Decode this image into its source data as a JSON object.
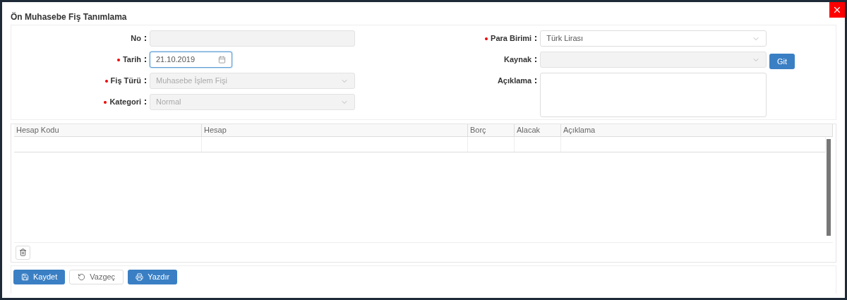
{
  "window": {
    "title": "Ön Muhasebe Fiş Tanımlama"
  },
  "form_left": [
    {
      "label": "No",
      "kind": "text",
      "required": false,
      "disabled": true,
      "focused": false
    },
    {
      "label": "Tarih",
      "kind": "date",
      "required": true,
      "disabled": false,
      "focused": true,
      "value": "21.10.2019"
    },
    {
      "label": "Fiş Türü",
      "kind": "select",
      "required": true,
      "disabled": true,
      "focused": false,
      "value": "Muhasebe İşlem Fişi"
    },
    {
      "label": "Kategori",
      "kind": "select",
      "required": true,
      "disabled": true,
      "focused": false,
      "value": "Normal"
    }
  ],
  "form_right": [
    {
      "label": "Para Birimi",
      "kind": "select",
      "required": true,
      "disabled": false,
      "focused": false,
      "value": "Türk Lirası"
    },
    {
      "label": "Kaynak",
      "kind": "select",
      "required": false,
      "disabled": true,
      "focused": false
    },
    {
      "label": "Açıklama",
      "kind": "textarea",
      "required": false,
      "disabled": false,
      "focused": false
    }
  ],
  "go_button": "Git",
  "table": {
    "columns": [
      "Hesap Kodu",
      "Hesap",
      "Borç",
      "Alacak",
      "Açıklama"
    ]
  },
  "buttons": [
    {
      "label": "Kaydet",
      "kind": "primary"
    },
    {
      "label": "Vazgeç",
      "kind": "default"
    },
    {
      "label": "Yazdır",
      "kind": "primary"
    }
  ]
}
